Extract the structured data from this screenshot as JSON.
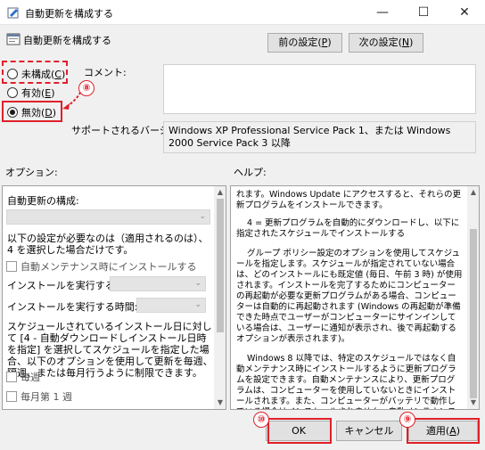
{
  "window": {
    "title": "自動更新を構成する",
    "icons": {
      "app": "policy-edit-icon",
      "minimize": "minimize-icon",
      "maximize": "maximize-icon",
      "close": "close-icon"
    }
  },
  "header": {
    "policy_name": "自動更新を構成する",
    "prev_button": {
      "label": "前の設定(",
      "key": "P",
      "suffix": ")"
    },
    "next_button": {
      "label": "次の設定(",
      "key": "N",
      "suffix": ")"
    }
  },
  "state": {
    "not_configured": {
      "label": "未構成(",
      "key": "C",
      "suffix": ")",
      "checked": false
    },
    "enabled": {
      "label": "有効(",
      "key": "E",
      "suffix": ")",
      "checked": false
    },
    "disabled": {
      "label": "無効(",
      "key": "D",
      "suffix": ")",
      "checked": true
    }
  },
  "comment_label": "コメント:",
  "supported_label": "サポートされるバージョン:",
  "supported_value": "Windows XP Professional Service Pack 1、または Windows 2000 Service Pack 3 以降",
  "options": {
    "header": "オプション:",
    "configure_label": "自動更新の構成:",
    "note": "以下の設定が必要なのは（適用されるのは）、4 を選択した場合だけです。",
    "install_maintenance": "自動メンテナンス時にインストールする",
    "install_day_label": "インストールを実行する日:",
    "install_time_label": "インストールを実行する時間:",
    "schedule_note": "スケジュールされているインストール日に対して [4 - 自動ダウンロードしインストール日時を指定] を選択してスケジュールを指定した場合、以下のオプションを使用して更新を毎週、隔週、または毎月行うように制限できます。",
    "every_week": "毎週",
    "first_week": "毎月第 1 週"
  },
  "help": {
    "header": "ヘルプ:",
    "paragraphs": [
      "れます。Windows Update にアクセスすると、それらの更新プログラムをインストールできます。",
      "4 = 更新プログラムを自動的にダウンロードし、以下に指定されたスケジュールでインストールする",
      "グループ ポリシー設定のオプションを使用してスケジュールを指定します。スケジュールが指定されていない場合は、どのインストールにも既定値 (毎日、午前 3 時) が使用されます。インストールを完了するためにコンピューターの再起動が必要な更新プログラムがある場合、コンピューターは自動的に再起動されます (Windows の再起動が準備できた時点でユーザーがコンピューターにサインインしている場合は、ユーザーに通知が表示され、後で再起動するオプションが表示されます)。",
      "Windows 8 以降では、特定のスケジュールではなく自動メンテナンス時にインストールするように更新プログラムを設定できます。自動メンテナンスにより、更新プログラムは、コンピューターを使用していないときにインストールされます。また、コンピューターがバッテリで動作している場合はインストールされません。自動メンテナンスで更新プログラ"
    ]
  },
  "footer": {
    "ok": "OK",
    "cancel": "キャンセル",
    "apply": {
      "label": "適用(",
      "key": "A",
      "suffix": ")"
    }
  },
  "annotations": {
    "n8": "⑧",
    "n9": "⑨",
    "n10": "⑩",
    "color": "#e0202a"
  }
}
